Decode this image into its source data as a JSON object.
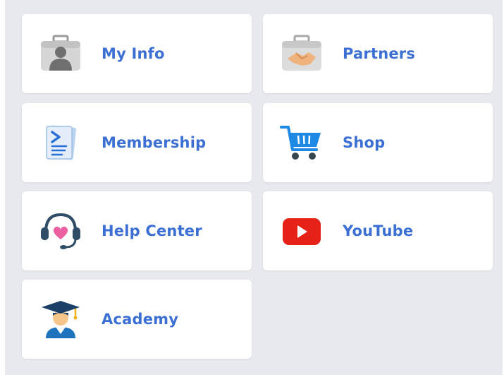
{
  "menu": {
    "items": [
      {
        "label": "My Info",
        "icon": "person-briefcase-icon"
      },
      {
        "label": "Partners",
        "icon": "handshake-briefcase-icon"
      },
      {
        "label": "Membership",
        "icon": "document-icon"
      },
      {
        "label": "Shop",
        "icon": "shopping-cart-icon"
      },
      {
        "label": "Help Center",
        "icon": "headset-heart-icon"
      },
      {
        "label": "YouTube",
        "icon": "youtube-icon"
      },
      {
        "label": "Academy",
        "icon": "graduate-icon"
      }
    ]
  },
  "colors": {
    "label": "#3b6fd3",
    "background": "#e8e9ee",
    "tile": "#ffffff",
    "youtube_red": "#e62117",
    "cart_blue": "#1e88e5"
  }
}
